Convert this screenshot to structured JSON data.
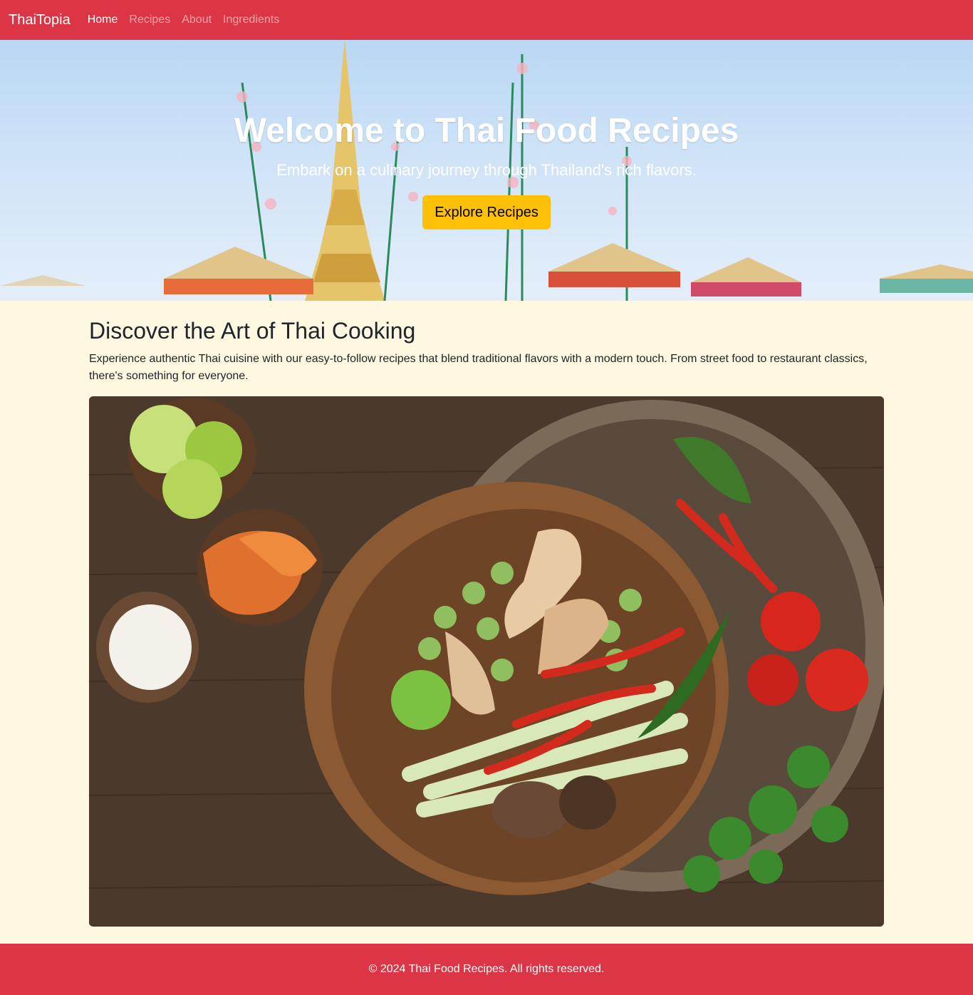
{
  "nav": {
    "brand": "ThaiTopia",
    "links": [
      {
        "label": "Home",
        "active": true
      },
      {
        "label": "Recipes",
        "active": false
      },
      {
        "label": "About",
        "active": false
      },
      {
        "label": "Ingredients",
        "active": false
      }
    ]
  },
  "hero": {
    "title": "Welcome to Thai Food Recipes",
    "subtitle": "Embark on a culinary journey through Thailand's rich flavors.",
    "button_label": "Explore Recipes"
  },
  "main": {
    "heading": "Discover the Art of Thai Cooking",
    "description": "Experience authentic Thai cuisine with our easy-to-follow recipes that blend traditional flavors with a modern touch. From street food to restaurant classics, there's something for everyone."
  },
  "footer": {
    "copyright": "© 2024 Thai Food Recipes. All rights reserved."
  },
  "colors": {
    "primary": "#dc3545",
    "accent": "#ffc107",
    "background": "#fff8e1"
  }
}
